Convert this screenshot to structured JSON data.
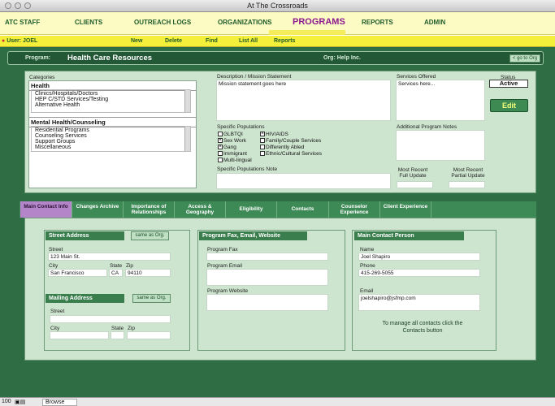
{
  "window": {
    "title": "At The Crossroads"
  },
  "nav": {
    "atc_staff": "ATC STAFF",
    "clients": "CLIENTS",
    "outreach_logs": "OUTREACH LOGS",
    "organizations": "ORGANIZATIONS",
    "programs": "PROGRAMS",
    "reports": "REPORTS",
    "admin": "ADMIN"
  },
  "toolbar": {
    "user": "User: JOEL",
    "new": "New",
    "delete": "Delete",
    "find": "Find",
    "list_all": "List All",
    "reports": "Reports"
  },
  "program": {
    "label": "Program:",
    "name": "Health Care Resources",
    "org": "Org: Help Inc.",
    "goto_org": "< go to Org"
  },
  "categories": {
    "label": "Categories",
    "group1_title": "Health",
    "group1_items": [
      "Clinics/Hospitals/Doctors",
      "HEP C/STD Services/Testing",
      "Alternative Health"
    ],
    "group2_title": "Mental Health/Counseling",
    "group2_items": [
      "Residential Programs",
      "Counseling Services",
      "Support Groups",
      "Miscellaneous"
    ]
  },
  "description": {
    "label": "Description / Mission Statement",
    "value": "Mission statement goes here"
  },
  "services": {
    "label": "Services Offered",
    "value": "Services here..."
  },
  "status": {
    "label": "Status",
    "value": "Active",
    "edit": "Edit"
  },
  "populations": {
    "label": "Specific Populations",
    "col1": [
      {
        "label": "GLBTQI",
        "checked": false
      },
      {
        "label": "Sex Work",
        "checked": true
      },
      {
        "label": "Gang",
        "checked": true
      },
      {
        "label": "Immigrant",
        "checked": false
      },
      {
        "label": "Multi-lingual",
        "checked": false
      }
    ],
    "col2": [
      {
        "label": "HIV/AIDS",
        "checked": true
      },
      {
        "label": "Family/Couple Services",
        "checked": false
      },
      {
        "label": "Differently Abled",
        "checked": false
      },
      {
        "label": "Ethnic/Cultural Services",
        "checked": false
      }
    ],
    "note_label": "Specific Populations Note"
  },
  "notes": {
    "label": "Additional Program Notes",
    "full_update": "Most Recent Full Update",
    "partial_update": "Most Recent Partial Update"
  },
  "tabs": [
    "Main Contact Info",
    "Changes Archive",
    "Importance of Relationships",
    "Access & Geography",
    "Eligibility",
    "Contacts",
    "Counselor Experience",
    "Client Experience"
  ],
  "street": {
    "title": "Street Address",
    "same_as": "same as Org.",
    "street_label": "Street",
    "street": "123 Main St.",
    "city_label": "City",
    "city": "San Francisco",
    "state_label": "State",
    "state": "CA",
    "zip_label": "Zip",
    "zip": "94110"
  },
  "mailing": {
    "title": "Mailing Address",
    "same_as": "same as Org.",
    "street_label": "Street",
    "city_label": "City",
    "state_label": "State",
    "zip_label": "Zip"
  },
  "fax": {
    "title": "Program Fax, Email,  Website",
    "fax_label": "Program Fax",
    "email_label": "Program Email",
    "website_label": "Program Website"
  },
  "contact": {
    "title": "Main Contact Person",
    "name_label": "Name",
    "name": "Joel Shapiro",
    "phone_label": "Phone",
    "phone": "415-269-5055",
    "email_label": "Email",
    "email": "joelshapiro@jsfmp.com",
    "note": "To manage all contacts click the Contacts button"
  },
  "statusbar": {
    "zoom": "100",
    "mode": "Browse"
  }
}
